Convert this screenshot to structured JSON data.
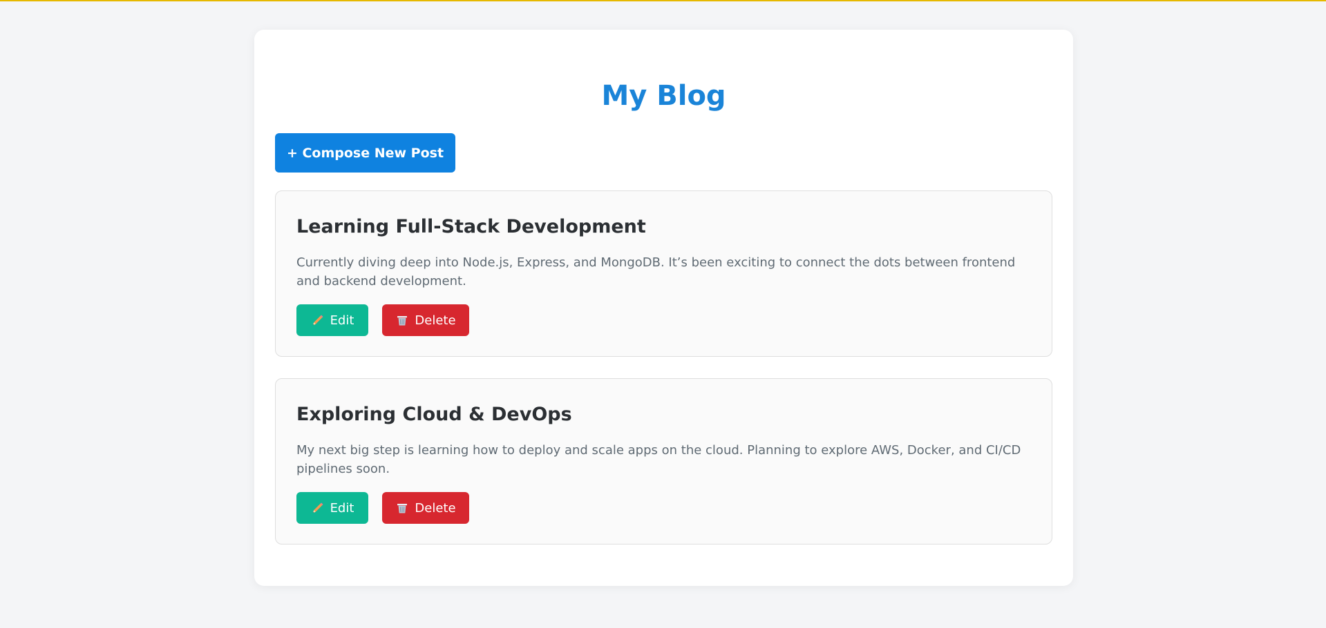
{
  "header": {
    "title": "My Blog"
  },
  "toolbar": {
    "compose_label": "+ Compose New Post"
  },
  "posts": [
    {
      "title": "Learning Full-Stack Development",
      "body": "Currently diving deep into Node.js, Express, and MongoDB. It’s been exciting to connect the dots between frontend and backend development.",
      "edit_label": "Edit",
      "delete_label": "Delete"
    },
    {
      "title": "Exploring Cloud & DevOps",
      "body": "My next big step is learning how to deploy and scale apps on the cloud. Planning to explore AWS, Docker, and CI/CD pipelines soon.",
      "edit_label": "Edit",
      "delete_label": "Delete"
    }
  ],
  "icons": {
    "edit": "pencil-icon",
    "delete": "trash-icon"
  },
  "colors": {
    "title": "#1a84d8",
    "compose_button": "#0f82e0",
    "edit_button": "#0db894",
    "delete_button": "#d7272f",
    "top_border": "#e6b800",
    "background": "#f4f5f7"
  }
}
